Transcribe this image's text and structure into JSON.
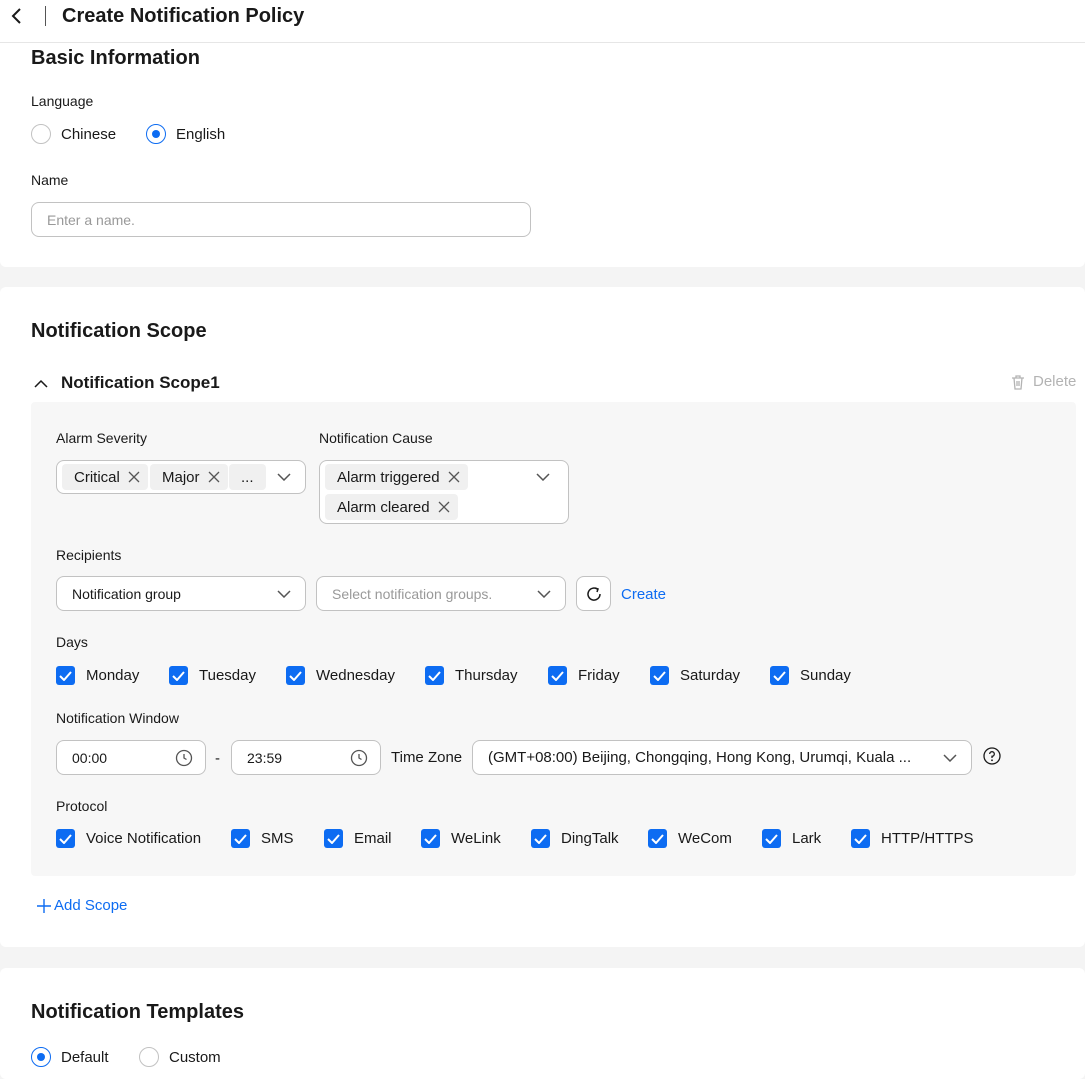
{
  "header": {
    "title": "Create Notification Policy"
  },
  "basic": {
    "title": "Basic Information",
    "language_label": "Language",
    "language_options": [
      {
        "label": "Chinese",
        "checked": false
      },
      {
        "label": "English",
        "checked": true
      }
    ],
    "name_label": "Name",
    "name_placeholder": "Enter a name."
  },
  "scope": {
    "title": "Notification Scope",
    "item_title": "Notification Scope1",
    "delete_label": "Delete",
    "alarm_severity_label": "Alarm Severity",
    "alarm_severity_tags": [
      "Critical",
      "Major"
    ],
    "alarm_severity_more": "...",
    "cause_label": "Notification Cause",
    "cause_tags": [
      "Alarm triggered",
      "Alarm cleared"
    ],
    "recipients_label": "Recipients",
    "recipient_type": "Notification group",
    "groups_placeholder": "Select notification groups.",
    "create_link": "Create",
    "days_label": "Days",
    "days": [
      "Monday",
      "Tuesday",
      "Wednesday",
      "Thursday",
      "Friday",
      "Saturday",
      "Sunday"
    ],
    "window_label": "Notification Window",
    "start_time": "00:00",
    "time_separator": "-",
    "end_time": "23:59",
    "timezone_label": "Time Zone",
    "timezone_value": "(GMT+08:00) Beijing, Chongqing, Hong Kong, Urumqi, Kuala ...",
    "protocol_label": "Protocol",
    "protocols": [
      "Voice Notification",
      "SMS",
      "Email",
      "WeLink",
      "DingTalk",
      "WeCom",
      "Lark",
      "HTTP/HTTPS"
    ],
    "add_scope": "Add Scope"
  },
  "templates": {
    "title": "Notification Templates",
    "options": [
      {
        "label": "Default",
        "checked": true
      },
      {
        "label": "Custom",
        "checked": false
      }
    ]
  },
  "colors": {
    "accent": "#0d6cf2",
    "border": "#c2c2c2",
    "panel": "#f7f7f7",
    "page_bg": "#f4f4f4"
  }
}
